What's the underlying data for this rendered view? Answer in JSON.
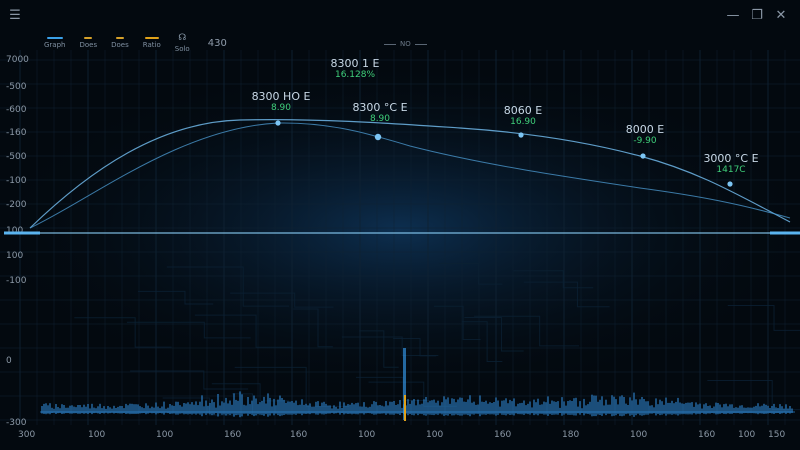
{
  "window": {
    "menu_icon": "hamburger-menu-icon",
    "controls": [
      "minimize-icon",
      "restore-icon",
      "close-icon"
    ]
  },
  "legend": {
    "items": [
      {
        "label": "Graph",
        "color": "#3aa0e8"
      },
      {
        "label": "Does",
        "color": "#d6a12a"
      },
      {
        "label": "Does",
        "color": "#d6a12a"
      },
      {
        "label": "Ratio",
        "color": "#e0a21a"
      },
      {
        "label": "Solo",
        "color": "#8fa0b0"
      }
    ],
    "count": "430",
    "mode_label": "NO"
  },
  "y_axis_labels": [
    "7000",
    "-500",
    "-600",
    "-160",
    "-500",
    "-100",
    "-200",
    "100",
    "100",
    "-100",
    "0",
    "-300"
  ],
  "x_axis_labels": [
    "300",
    "100",
    "100",
    "160",
    "160",
    "100",
    "100",
    "160",
    "180",
    "100",
    "160",
    "100",
    "150"
  ],
  "bands": [
    {
      "freq": "8300 1 E",
      "gain": "16.128%"
    },
    {
      "freq": "8300 HO E",
      "gain": "8.90"
    },
    {
      "freq": "8300 °C E",
      "gain": "8.90"
    },
    {
      "freq": "8060 E",
      "gain": "16.90"
    },
    {
      "freq": "8000 E",
      "gain": "-9.90"
    },
    {
      "freq": "3000 °C E",
      "gain": "1417C"
    }
  ],
  "colors": {
    "accent": "#3aa7ff",
    "wave": "#2f8fe0",
    "gain": "#3fcf7a",
    "marker": "#e0a21a"
  }
}
